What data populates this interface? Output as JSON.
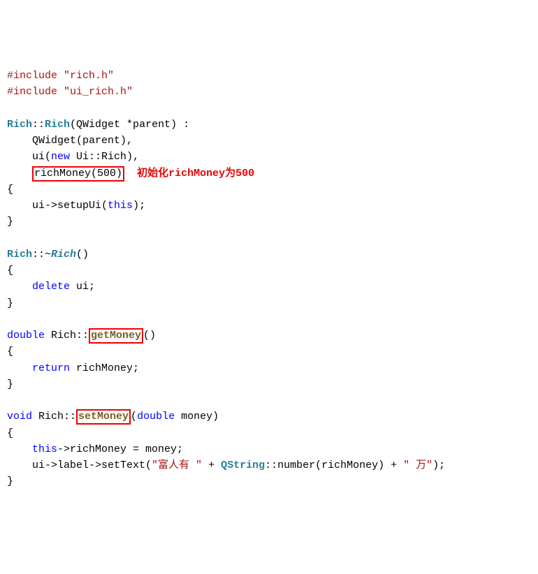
{
  "include1_key": "#include",
  "include1_val": "\"rich.h\"",
  "include2_key": "#include",
  "include2_val": "\"ui_rich.h\"",
  "ctor_class1": "Rich",
  "ctor_scope": "::",
  "ctor_class2": "Rich",
  "ctor_params": "(QWidget *parent) :",
  "ctor_line1": "QWidget(parent),",
  "ctor_line2_ui": "ui(",
  "ctor_line2_new": "new",
  "ctor_line2_cls": " Ui::Rich",
  "ctor_line2_end": "),",
  "ctor_line3": "richMoney(500)",
  "annotation1": "初始化richMoney为500",
  "brace_open": "{",
  "ctor_body": "ui->setupUi(",
  "ctor_body_this": "this",
  "ctor_body_end": ");",
  "brace_close": "}",
  "dtor_class": "Rich",
  "dtor_scope": "::~",
  "dtor_name": "Rich",
  "dtor_paren": "()",
  "dtor_body": "delete",
  "dtor_body2": " ui;",
  "getfn_ret": "double",
  "getfn_cls": " Rich::",
  "getfn_name": "getMoney",
  "getfn_paren": "()",
  "getfn_body_ret": "return",
  "getfn_body_rest": " richMoney;",
  "setfn_ret": "void",
  "setfn_cls": " Rich::",
  "setfn_name": "setMoney",
  "setfn_params_open": "(",
  "setfn_params_type": "double",
  "setfn_params_rest": " money)",
  "setfn_body1_this": "this",
  "setfn_body1_rest": "->richMoney = money;",
  "setfn_body2_a": "ui->label->setText(",
  "setfn_body2_str1": "\"富人有 \"",
  "setfn_body2_plus1": " + ",
  "setfn_body2_cls": "QString",
  "setfn_body2_num": "::number(richMoney) + ",
  "setfn_body2_str2": "\" 万\"",
  "setfn_body2_end": ");"
}
